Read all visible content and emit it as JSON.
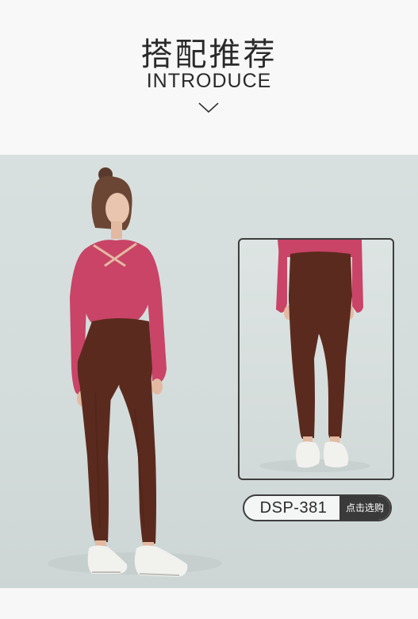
{
  "section": {
    "title_cn": "搭配推荐",
    "title_en": "INTRODUCE",
    "chevron_icon": "chevron-down-icon"
  },
  "product": {
    "code": "DSP-381",
    "buy_label": "点击选购"
  },
  "colors": {
    "top": "#c94467",
    "leggings": "#5b2a1e",
    "background": "#d5dddc"
  }
}
